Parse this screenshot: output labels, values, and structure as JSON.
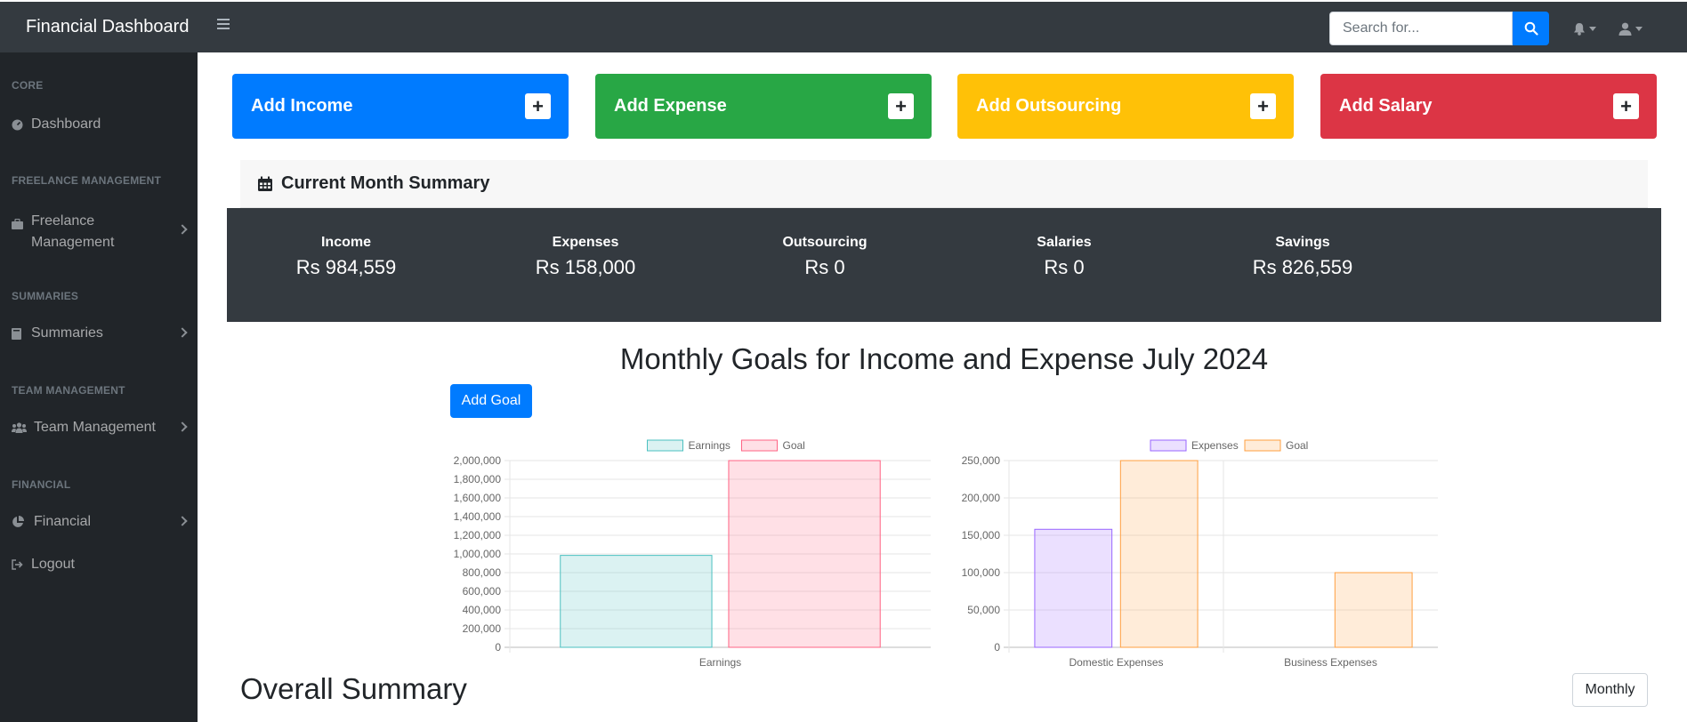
{
  "app": {
    "brand": "Financial Dashboard"
  },
  "topbar": {
    "search_placeholder": "Search for..."
  },
  "sidebar": {
    "sections": [
      {
        "heading": "Core",
        "items": [
          {
            "label": "Dashboard",
            "icon": "tachometer-icon"
          }
        ]
      },
      {
        "heading": "Freelance Management",
        "items": [
          {
            "label": "Freelance Management",
            "icon": "briefcase-icon"
          }
        ]
      },
      {
        "heading": "Summaries",
        "items": [
          {
            "label": "Summaries",
            "icon": "book-icon"
          }
        ]
      },
      {
        "heading": "Team Management",
        "items": [
          {
            "label": "Team Management",
            "icon": "users-icon"
          }
        ]
      },
      {
        "heading": "Financial",
        "items": [
          {
            "label": "Financial",
            "icon": "pie-chart-icon"
          },
          {
            "label": "Logout",
            "icon": "logout-icon"
          }
        ]
      }
    ]
  },
  "cards": [
    {
      "label": "Add Income",
      "color": "#007bff"
    },
    {
      "label": "Add Expense",
      "color": "#28a745"
    },
    {
      "label": "Add Outsourcing",
      "color": "#ffc107"
    },
    {
      "label": "Add Salary",
      "color": "#dc3545"
    }
  ],
  "summary": {
    "title": "Current Month Summary",
    "stats": [
      {
        "label": "Income",
        "value": "Rs 984,559"
      },
      {
        "label": "Expenses",
        "value": "Rs 158,000"
      },
      {
        "label": "Outsourcing",
        "value": "Rs 0"
      },
      {
        "label": "Salaries",
        "value": "Rs 0"
      },
      {
        "label": "Savings",
        "value": "Rs 826,559"
      }
    ]
  },
  "goals": {
    "title": "Monthly Goals for Income and Expense July 2024",
    "add_goal_label": "Add Goal"
  },
  "chart_data": [
    {
      "type": "bar",
      "categories": [
        "Earnings"
      ],
      "series": [
        {
          "name": "Earnings",
          "values": [
            984559
          ],
          "color": "#4bc0c0"
        },
        {
          "name": "Goal",
          "values": [
            2000000
          ],
          "color": "#ff6384"
        }
      ],
      "ylim": [
        0,
        2000000
      ],
      "yticks": [
        "0",
        "200,000",
        "400,000",
        "600,000",
        "800,000",
        "1,000,000",
        "1,200,000",
        "1,400,000",
        "1,600,000",
        "1,800,000",
        "2,000,000"
      ],
      "legend": "top"
    },
    {
      "type": "bar",
      "categories": [
        "Domestic Expenses",
        "Business Expenses"
      ],
      "series": [
        {
          "name": "Expenses",
          "values": [
            158000,
            0
          ],
          "color": "#9966ff"
        },
        {
          "name": "Goal",
          "values": [
            250000,
            100000
          ],
          "color": "#ff9f40"
        }
      ],
      "ylim": [
        0,
        250000
      ],
      "yticks": [
        "0",
        "50,000",
        "100,000",
        "150,000",
        "200,000",
        "250,000"
      ],
      "legend": "top"
    }
  ],
  "overall": {
    "title": "Overall Summary",
    "period_button": "Monthly"
  }
}
